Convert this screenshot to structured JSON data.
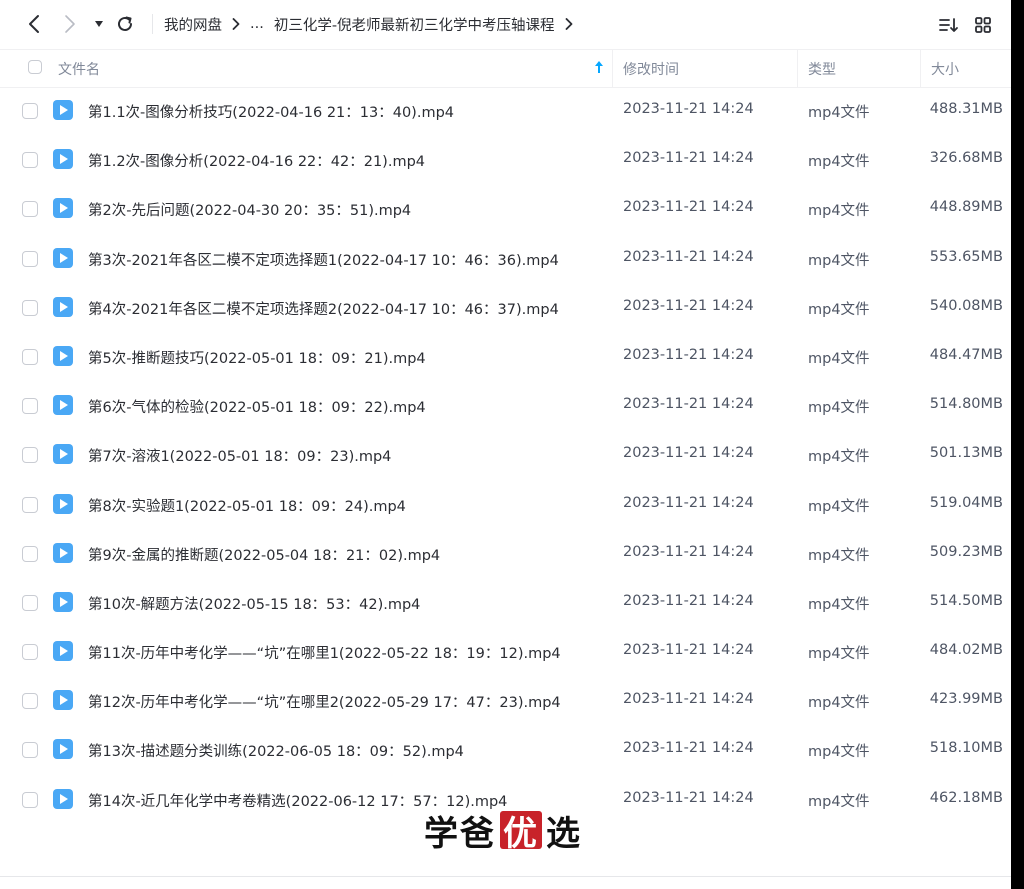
{
  "breadcrumb": {
    "root": "我的网盘",
    "ellipsis": "...",
    "current": "初三化学-倪老师最新初三化学中考压轴课程"
  },
  "table": {
    "columns": {
      "name": "文件名",
      "modified": "修改时间",
      "type": "类型",
      "size": "大小"
    },
    "sort": "name-ascending",
    "rows": [
      {
        "name": "第1.1次-图像分析技巧(2022-04-16 21：13：40).mp4",
        "modified": "2023-11-21 14:24",
        "type": "mp4文件",
        "size": "488.31MB"
      },
      {
        "name": "第1.2次-图像分析(2022-04-16 22：42：21).mp4",
        "modified": "2023-11-21 14:24",
        "type": "mp4文件",
        "size": "326.68MB"
      },
      {
        "name": "第2次-先后问题(2022-04-30 20：35：51).mp4",
        "modified": "2023-11-21 14:24",
        "type": "mp4文件",
        "size": "448.89MB"
      },
      {
        "name": "第3次-2021年各区二模不定项选择题1(2022-04-17 10：46：36).mp4",
        "modified": "2023-11-21 14:24",
        "type": "mp4文件",
        "size": "553.65MB"
      },
      {
        "name": "第4次-2021年各区二模不定项选择题2(2022-04-17 10：46：37).mp4",
        "modified": "2023-11-21 14:24",
        "type": "mp4文件",
        "size": "540.08MB"
      },
      {
        "name": "第5次-推断题技巧(2022-05-01 18：09：21).mp4",
        "modified": "2023-11-21 14:24",
        "type": "mp4文件",
        "size": "484.47MB"
      },
      {
        "name": "第6次-气体的检验(2022-05-01 18：09：22).mp4",
        "modified": "2023-11-21 14:24",
        "type": "mp4文件",
        "size": "514.80MB"
      },
      {
        "name": "第7次-溶液1(2022-05-01 18：09：23).mp4",
        "modified": "2023-11-21 14:24",
        "type": "mp4文件",
        "size": "501.13MB"
      },
      {
        "name": "第8次-实验题1(2022-05-01 18：09：24).mp4",
        "modified": "2023-11-21 14:24",
        "type": "mp4文件",
        "size": "519.04MB"
      },
      {
        "name": "第9次-金属的推断题(2022-05-04 18：21：02).mp4",
        "modified": "2023-11-21 14:24",
        "type": "mp4文件",
        "size": "509.23MB"
      },
      {
        "name": "第10次-解题方法(2022-05-15 18：53：42).mp4",
        "modified": "2023-11-21 14:24",
        "type": "mp4文件",
        "size": "514.50MB"
      },
      {
        "name": "第11次-历年中考化学——“坑”在哪里1(2022-05-22 18：19：12).mp4",
        "modified": "2023-11-21 14:24",
        "type": "mp4文件",
        "size": "484.02MB"
      },
      {
        "name": "第12次-历年中考化学——“坑”在哪里2(2022-05-29 17：47：23).mp4",
        "modified": "2023-11-21 14:24",
        "type": "mp4文件",
        "size": "423.99MB"
      },
      {
        "name": "第13次-描述题分类训练(2022-06-05 18：09：52).mp4",
        "modified": "2023-11-21 14:24",
        "type": "mp4文件",
        "size": "518.10MB"
      },
      {
        "name": "第14次-近几年化学中考卷精选(2022-06-12 17：57：12).mp4",
        "modified": "2023-11-21 14:24",
        "type": "mp4文件",
        "size": "462.18MB"
      }
    ]
  },
  "watermark": {
    "part1": "学爸",
    "part2": "优",
    "part3": "选"
  },
  "colors": {
    "accent": "#06a7ff",
    "video_icon": "#4aa8f5",
    "watermark_box": "#c8232a"
  },
  "icons": {
    "back": "chevron-left-icon",
    "forward": "chevron-right-icon",
    "dropdown": "caret-down-icon",
    "refresh": "refresh-icon",
    "sort": "sort-list-icon",
    "grid": "grid-view-icon",
    "file": "video-file-icon"
  }
}
